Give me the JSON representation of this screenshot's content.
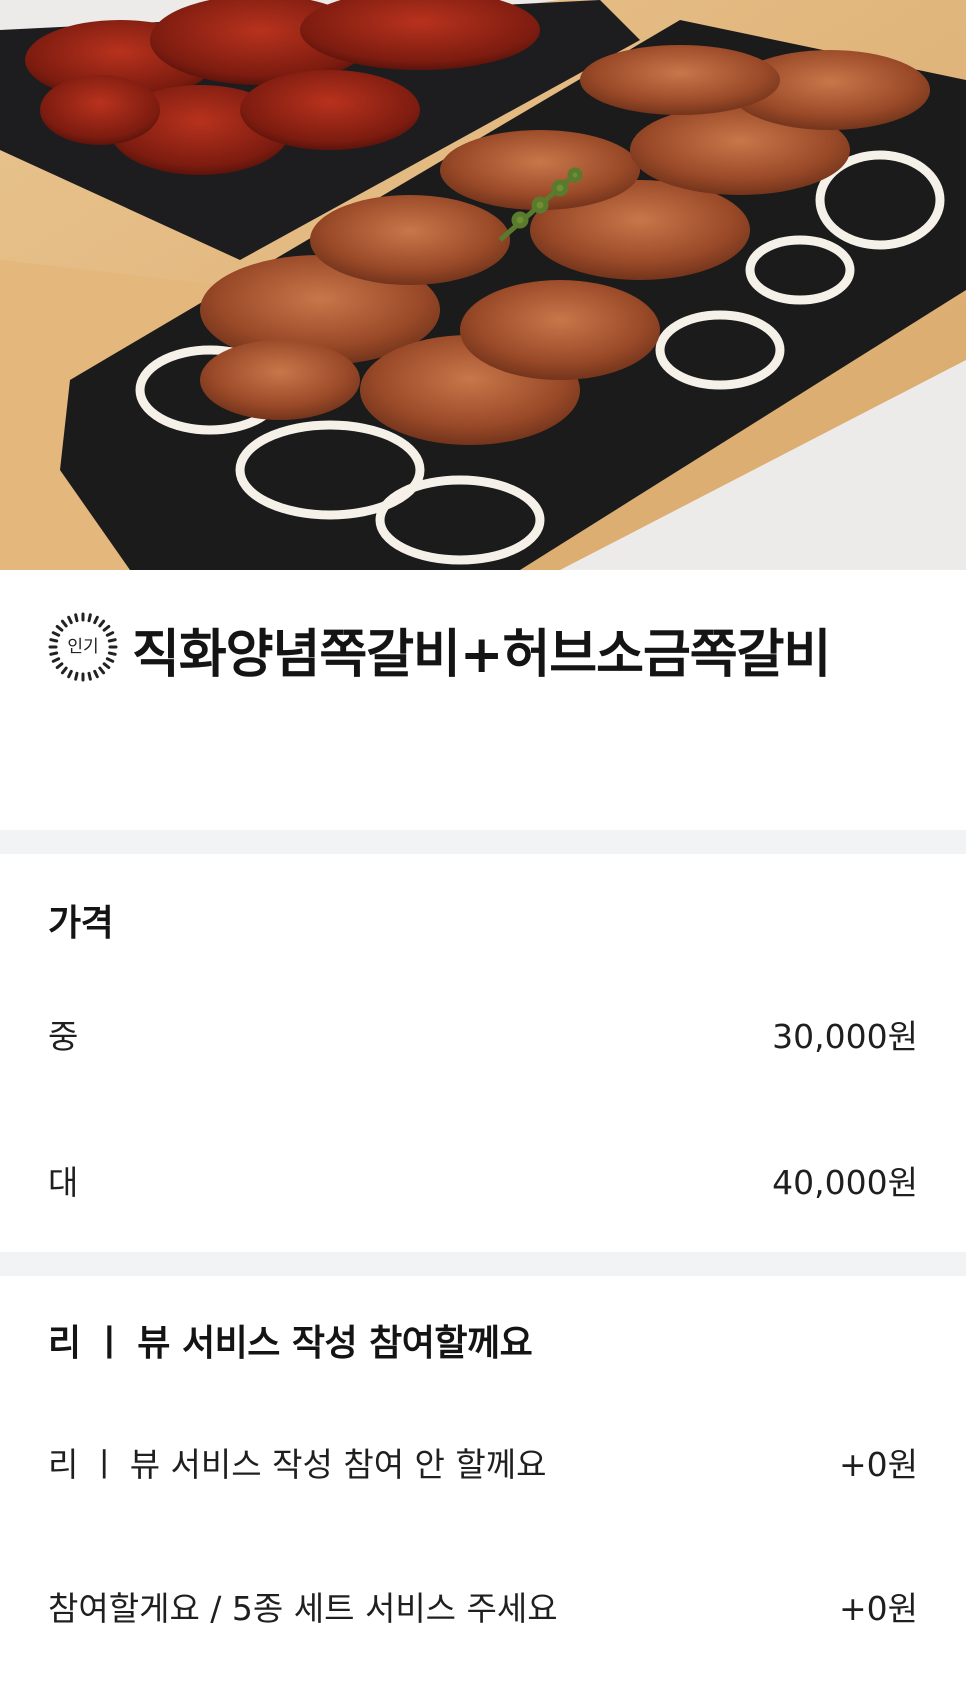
{
  "hero": {
    "image": "grilled-pork-ribs-photo"
  },
  "menu": {
    "badge": "인기",
    "title": "직화양념쪽갈비+허브소금쪽갈비"
  },
  "price_section": {
    "title": "가격",
    "options": [
      {
        "label": "중",
        "price": "30,000원"
      },
      {
        "label": "대",
        "price": "40,000원"
      }
    ]
  },
  "review_section": {
    "title": "리 ㅣ 뷰  서비스 작성 참여할께요",
    "options": [
      {
        "label": "리 ㅣ 뷰 서비스 작성 참여 안 할께요",
        "price": "+0원"
      },
      {
        "label": "참여할게요 / 5종 세트 서비스 주세요",
        "price": "+0원"
      }
    ]
  },
  "colors": {
    "divider": "#f2f3f5",
    "text": "#141414"
  }
}
